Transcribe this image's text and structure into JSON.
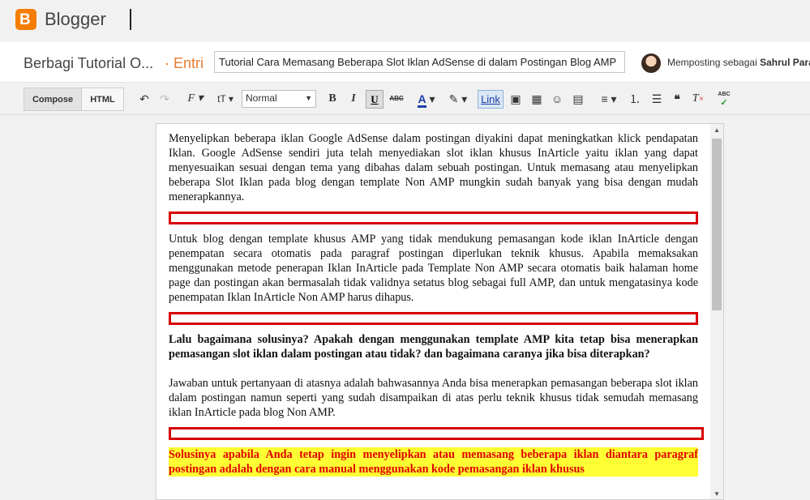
{
  "app": {
    "name": "Blogger",
    "logo_letter": "B"
  },
  "post": {
    "blog_name": "Berbagi Tutorial O...",
    "separator": "·",
    "entry_label": "Entri",
    "title_value": "Tutorial Cara Memasang Beberapa Slot Iklan AdSense di dalam Postingan Blog AMP",
    "posting_as_label": "Memposting sebagai",
    "user_name": "Sahrul Para"
  },
  "toolbar": {
    "compose_label": "Compose",
    "html_label": "HTML",
    "font_size_value": "Normal",
    "bold_label": "B",
    "italic_label": "I",
    "underline_label": "U",
    "strike_label": "ABC",
    "text_color_label": "A",
    "link_label": "Link",
    "spell_label": "ABC",
    "font_family_label": "F",
    "font_size_icon_label": "tT"
  },
  "content": {
    "paragraphs": [
      "Menyelipkan beberapa iklan Google AdSense dalam postingan diyakini dapat meningkatkan klick pendapatan Iklan. Google AdSense sendiri juta telah menyediakan slot iklan khusus InArticle yaitu iklan yang dapat menyesuaikan sesuai dengan tema yang dibahas dalam sebuah postingan. Untuk memasang atau menyelipkan  beberapa Slot Iklan pada blog dengan template Non AMP mungkin sudah banyak yang bisa dengan mudah menerapkannya.",
      "Untuk blog dengan template khusus AMP yang tidak mendukung pemasangan kode iklan InArticle dengan penempatan secara otomatis pada paragraf postingan diperlukan teknik khusus. Apabila memaksakan menggunakan metode penerapan Iklan InArticle pada Template Non AMP secara otomatis baik halaman home page dan postingan akan bermasalah tidak validnya setatus blog sebagai full AMP, dan untuk mengatasinya kode penempatan Iklan InArticle Non AMP harus dihapus.",
      "Lalu bagaimana solusinya? Apakah dengan menggunakan template AMP kita tetap bisa menerapkan pemasangan slot iklan dalam postingan atau tidak? dan bagaimana caranya jika bisa diterapkan?",
      "Jawaban untuk pertanyaan di atasnya adalah bahwasannya Anda bisa menerapkan pemasangan beberapa slot iklan dalam postingan namun seperti yang sudah  disampaikan di atas perlu teknik khusus tidak semudah memasang iklan InArticle pada blog Non AMP.",
      "Solusinya apabila Anda tetap ingin menyelipkan atau memasang beberapa iklan diantara paragraf postingan adalah dengan cara manual menggunakan kode pemasangan iklan khusus"
    ]
  },
  "colors": {
    "accent_orange": "#f57d00",
    "ad_slot_border": "#d60000",
    "highlight_bg": "#ffff33",
    "highlight_text": "#e00000"
  }
}
